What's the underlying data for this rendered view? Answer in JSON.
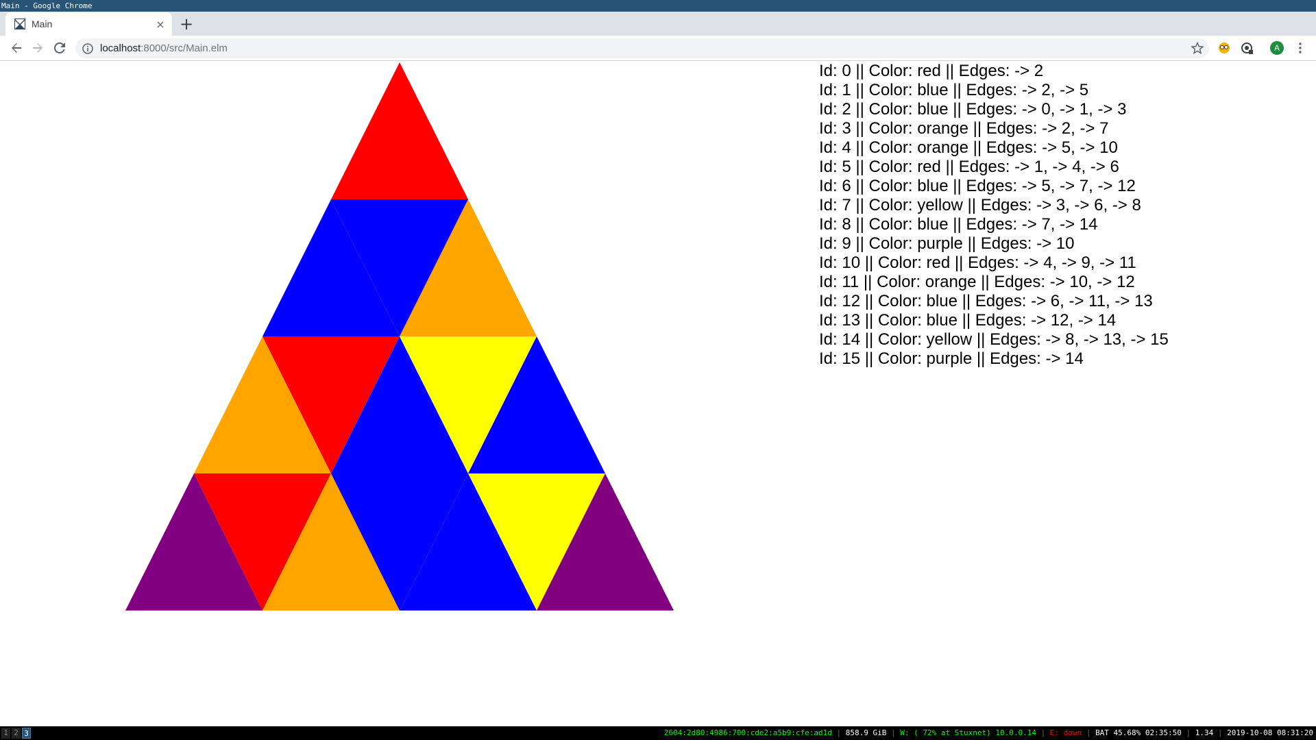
{
  "window": {
    "title": "Main - Google Chrome"
  },
  "tab": {
    "title": "Main",
    "close": "×",
    "new_tab": "+"
  },
  "address": {
    "host": "localhost",
    "rest": ":8000/src/Main.elm"
  },
  "profile": {
    "initial": "A"
  },
  "triangles": [
    {
      "color": "#ff0000"
    },
    {
      "color": "#0000ff"
    },
    {
      "color": "#0000ff"
    },
    {
      "color": "#ffa500"
    },
    {
      "color": "#ffa500"
    },
    {
      "color": "#ff0000"
    },
    {
      "color": "#0000ff"
    },
    {
      "color": "#ffff00"
    },
    {
      "color": "#0000ff"
    },
    {
      "color": "#800080"
    },
    {
      "color": "#ff0000"
    },
    {
      "color": "#ffa500"
    },
    {
      "color": "#0000ff"
    },
    {
      "color": "#0000ff"
    },
    {
      "color": "#ffff00"
    },
    {
      "color": "#800080"
    }
  ],
  "nodes": [
    "Id: 0 || Color: red || Edges: -> 2",
    "Id: 1 || Color: blue || Edges: -> 2, -> 5",
    "Id: 2 || Color: blue || Edges: -> 0, -> 1, -> 3",
    "Id: 3 || Color: orange || Edges: -> 2, -> 7",
    "Id: 4 || Color: orange || Edges: -> 5, -> 10",
    "Id: 5 || Color: red || Edges: -> 1, -> 4, -> 6",
    "Id: 6 || Color: blue || Edges: -> 5, -> 7, -> 12",
    "Id: 7 || Color: yellow || Edges: -> 3, -> 6, -> 8",
    "Id: 8 || Color: blue || Edges: -> 7, -> 14",
    "Id: 9 || Color: purple || Edges: -> 10",
    "Id: 10 || Color: red || Edges: -> 4, -> 9, -> 11",
    "Id: 11 || Color: orange || Edges: -> 10, -> 12",
    "Id: 12 || Color: blue || Edges: -> 6, -> 11, -> 13",
    "Id: 13 || Color: blue || Edges: -> 12, -> 14",
    "Id: 14 || Color: yellow || Edges: -> 8, -> 13, -> 15",
    "Id: 15 || Color: purple || Edges: -> 14"
  ],
  "statusbar": {
    "workspaces": [
      {
        "label": "1",
        "active": false
      },
      {
        "label": "2",
        "active": false
      },
      {
        "label": "3",
        "active": true
      }
    ],
    "ipv6": "2604:2d80:4986:700:cde2:a5b9:cfe:ad1d",
    "disk": "858.9 GiB",
    "wifi": "W: ( 72% at Stuxnet) 10.0.0.14",
    "ethernet": "E: down",
    "battery": "BAT 45.68% 02:35:50",
    "load": "1.34",
    "datetime": "2019-10-08 08:31:20"
  }
}
